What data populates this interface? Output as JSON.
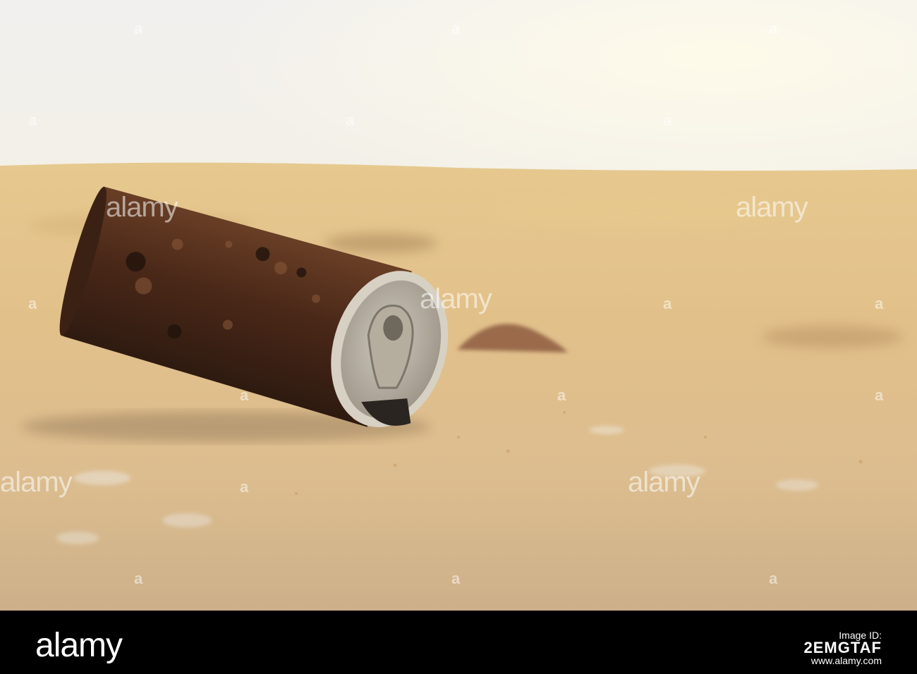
{
  "watermark": {
    "text": "alamy",
    "small_mark": "a"
  },
  "footer": {
    "logo": "alamy",
    "caption": "Image ID: 2EMGTAF",
    "image_id_label": "Image ID:",
    "image_id": "2EMGTAF",
    "url": "www.alamy.com",
    "background": "#000000"
  },
  "colors": {
    "sky_top": "#f4f2ee",
    "sky_glow": "#fbefcf",
    "sand_far": "#e3c386",
    "sand_near": "#d8b98a",
    "can_body": "#4a2a1a",
    "can_lid": "#b9b3a8"
  }
}
